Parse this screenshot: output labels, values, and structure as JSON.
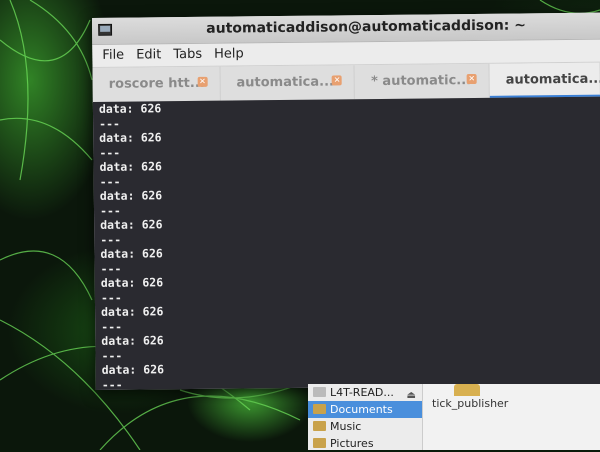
{
  "window": {
    "title": "automaticaddison@automaticaddison: ~"
  },
  "menu": [
    "File",
    "Edit",
    "Tabs",
    "Help"
  ],
  "tabs": [
    {
      "label": "roscore htt...",
      "active": false
    },
    {
      "label": "automatica...",
      "active": false
    },
    {
      "label": "* automatic...",
      "active": false
    },
    {
      "label": "automatica...",
      "active": true
    }
  ],
  "terminal": {
    "lines": [
      "data: 626",
      "---",
      "data: 626",
      "---",
      "data: 626",
      "---",
      "data: 626",
      "---",
      "data: 626",
      "---",
      "data: 626",
      "---",
      "data: 626",
      "---",
      "data: 626",
      "---",
      "data: 626",
      "---",
      "data: 626",
      "---"
    ]
  },
  "file_manager": {
    "sidebar": [
      {
        "label": "L4T-READ...",
        "selected": false,
        "icon": "drive-icon"
      },
      {
        "label": "Documents",
        "selected": true,
        "icon": "folder-icon"
      },
      {
        "label": "Music",
        "selected": false,
        "icon": "folder-icon"
      },
      {
        "label": "Pictures",
        "selected": false,
        "icon": "folder-icon"
      }
    ],
    "file": "tick_publisher"
  },
  "colors": {
    "terminal_bg": "#2a2a30",
    "accent": "#3a7fd5",
    "wallpaper_glow": "#50dc3c"
  }
}
